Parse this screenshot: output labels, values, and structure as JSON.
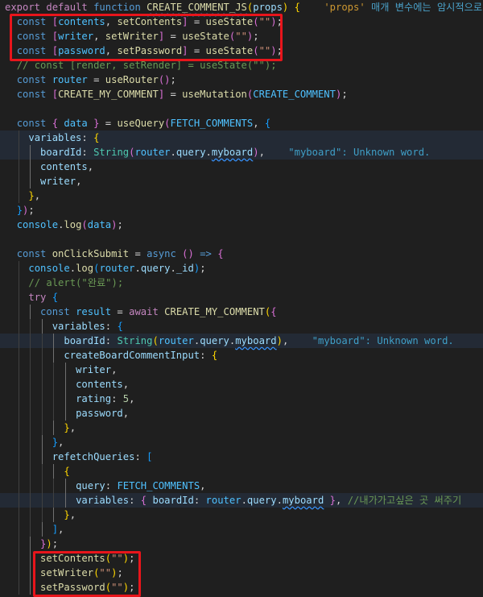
{
  "colors": {
    "editor_background": "#1f1f1f",
    "highlight_box": "#e8151b",
    "keyword": "#569cd6",
    "function": "#dcdcaa",
    "string": "#ce9178",
    "variable": "#9cdcfe",
    "comment": "#6a9955"
  },
  "lines": [
    {
      "indent": 0,
      "tokens": [
        {
          "t": "export",
          "c": "ctrl"
        },
        {
          "t": " ",
          "c": "p"
        },
        {
          "t": "default",
          "c": "ctrl"
        },
        {
          "t": " ",
          "c": "p"
        },
        {
          "t": "function",
          "c": "kw"
        },
        {
          "t": " ",
          "c": "p"
        },
        {
          "t": "CREATE_COMMENT_JS",
          "c": "fn sq"
        },
        {
          "t": "(",
          "c": "b1"
        },
        {
          "t": "props",
          "c": "var"
        },
        {
          "t": ")",
          "c": "b1"
        },
        {
          "t": " ",
          "c": "p"
        },
        {
          "t": "{",
          "c": "b1"
        },
        {
          "t": "    ",
          "c": "p"
        },
        {
          "t": "'props'",
          "c": "hintk"
        },
        {
          "t": " 매개 변수에는 암시적으로 'a",
          "c": "hint warn"
        }
      ]
    },
    {
      "indent": 1,
      "tokens": [
        {
          "t": "const",
          "c": "kw"
        },
        {
          "t": " ",
          "c": "p"
        },
        {
          "t": "[",
          "c": "b2"
        },
        {
          "t": "contents",
          "c": "cst"
        },
        {
          "t": ", ",
          "c": "p"
        },
        {
          "t": "setContents",
          "c": "fn"
        },
        {
          "t": "]",
          "c": "b2"
        },
        {
          "t": " = ",
          "c": "p"
        },
        {
          "t": "useState",
          "c": "fn"
        },
        {
          "t": "(",
          "c": "b2"
        },
        {
          "t": "\"\"",
          "c": "str"
        },
        {
          "t": ")",
          "c": "b2"
        },
        {
          "t": ";",
          "c": "p"
        }
      ]
    },
    {
      "indent": 1,
      "tokens": [
        {
          "t": "const",
          "c": "kw"
        },
        {
          "t": " ",
          "c": "p"
        },
        {
          "t": "[",
          "c": "b2"
        },
        {
          "t": "writer",
          "c": "cst"
        },
        {
          "t": ", ",
          "c": "p"
        },
        {
          "t": "setWriter",
          "c": "fn"
        },
        {
          "t": "]",
          "c": "b2"
        },
        {
          "t": " = ",
          "c": "p"
        },
        {
          "t": "useState",
          "c": "fn"
        },
        {
          "t": "(",
          "c": "b2"
        },
        {
          "t": "\"\"",
          "c": "str"
        },
        {
          "t": ")",
          "c": "b2"
        },
        {
          "t": ";",
          "c": "p"
        }
      ]
    },
    {
      "indent": 1,
      "tokens": [
        {
          "t": "const",
          "c": "kw"
        },
        {
          "t": " ",
          "c": "p"
        },
        {
          "t": "[",
          "c": "b2"
        },
        {
          "t": "password",
          "c": "cst"
        },
        {
          "t": ", ",
          "c": "p"
        },
        {
          "t": "setPassword",
          "c": "fn"
        },
        {
          "t": "]",
          "c": "b2"
        },
        {
          "t": " = ",
          "c": "p"
        },
        {
          "t": "useState",
          "c": "fn"
        },
        {
          "t": "(",
          "c": "b2"
        },
        {
          "t": "\"\"",
          "c": "str"
        },
        {
          "t": ")",
          "c": "b2"
        },
        {
          "t": ";",
          "c": "p"
        }
      ]
    },
    {
      "indent": 1,
      "tokens": [
        {
          "t": "// const [render, setRender] = useState(\"\");",
          "c": "cmt"
        }
      ]
    },
    {
      "indent": 1,
      "tokens": [
        {
          "t": "const",
          "c": "kw"
        },
        {
          "t": " ",
          "c": "p"
        },
        {
          "t": "router",
          "c": "cst"
        },
        {
          "t": " = ",
          "c": "p"
        },
        {
          "t": "useRouter",
          "c": "fn"
        },
        {
          "t": "()",
          "c": "b2"
        },
        {
          "t": ";",
          "c": "p"
        }
      ]
    },
    {
      "indent": 1,
      "tokens": [
        {
          "t": "const",
          "c": "kw"
        },
        {
          "t": " ",
          "c": "p"
        },
        {
          "t": "[",
          "c": "b2"
        },
        {
          "t": "CREATE_MY_COMMENT",
          "c": "fn"
        },
        {
          "t": "]",
          "c": "b2"
        },
        {
          "t": " = ",
          "c": "p"
        },
        {
          "t": "useMutation",
          "c": "fn"
        },
        {
          "t": "(",
          "c": "b2"
        },
        {
          "t": "CREATE_COMMENT",
          "c": "cst"
        },
        {
          "t": ")",
          "c": "b2"
        },
        {
          "t": ";",
          "c": "p"
        }
      ]
    },
    {
      "indent": 0,
      "tokens": []
    },
    {
      "indent": 1,
      "tokens": [
        {
          "t": "const",
          "c": "kw"
        },
        {
          "t": " ",
          "c": "p"
        },
        {
          "t": "{",
          "c": "b2"
        },
        {
          "t": " data ",
          "c": "cst"
        },
        {
          "t": "}",
          "c": "b2"
        },
        {
          "t": " = ",
          "c": "p"
        },
        {
          "t": "useQuery",
          "c": "fn"
        },
        {
          "t": "(",
          "c": "b2"
        },
        {
          "t": "FETCH_COMMENTS",
          "c": "cst"
        },
        {
          "t": ", ",
          "c": "p"
        },
        {
          "t": "{",
          "c": "b3"
        }
      ]
    },
    {
      "indent": 2,
      "hl": true,
      "tokens": [
        {
          "t": "variables",
          "c": "var"
        },
        {
          "t": ": ",
          "c": "p"
        },
        {
          "t": "{",
          "c": "b1"
        }
      ]
    },
    {
      "indent": 3,
      "hl": true,
      "tokens": [
        {
          "t": "boardId",
          "c": "var"
        },
        {
          "t": ": ",
          "c": "p"
        },
        {
          "t": "String",
          "c": "type"
        },
        {
          "t": "(",
          "c": "b2"
        },
        {
          "t": "router",
          "c": "cst"
        },
        {
          "t": ".",
          "c": "p"
        },
        {
          "t": "query",
          "c": "var"
        },
        {
          "t": ".",
          "c": "p"
        },
        {
          "t": "myboard",
          "c": "var sq"
        },
        {
          "t": ")",
          "c": "b2"
        },
        {
          "t": ",",
          "c": "p"
        },
        {
          "t": "    ",
          "c": "p"
        },
        {
          "t": "\"myboard\": Unknown word.",
          "c": "hint"
        }
      ]
    },
    {
      "indent": 3,
      "tokens": [
        {
          "t": "contents",
          "c": "var"
        },
        {
          "t": ",",
          "c": "p"
        }
      ]
    },
    {
      "indent": 3,
      "tokens": [
        {
          "t": "writer",
          "c": "var"
        },
        {
          "t": ",",
          "c": "p"
        }
      ]
    },
    {
      "indent": 2,
      "tokens": [
        {
          "t": "}",
          "c": "b1"
        },
        {
          "t": ",",
          "c": "p"
        }
      ]
    },
    {
      "indent": 1,
      "tokens": [
        {
          "t": "}",
          "c": "b3"
        },
        {
          "t": ")",
          "c": "b2"
        },
        {
          "t": ";",
          "c": "p"
        }
      ]
    },
    {
      "indent": 1,
      "tokens": [
        {
          "t": "console",
          "c": "cst"
        },
        {
          "t": ".",
          "c": "p"
        },
        {
          "t": "log",
          "c": "fn"
        },
        {
          "t": "(",
          "c": "b2"
        },
        {
          "t": "data",
          "c": "cst"
        },
        {
          "t": ")",
          "c": "b2"
        },
        {
          "t": ";",
          "c": "p"
        }
      ]
    },
    {
      "indent": 0,
      "tokens": []
    },
    {
      "indent": 1,
      "tokens": [
        {
          "t": "const",
          "c": "kw"
        },
        {
          "t": " ",
          "c": "p"
        },
        {
          "t": "onClickSubmit",
          "c": "fn"
        },
        {
          "t": " = ",
          "c": "p"
        },
        {
          "t": "async",
          "c": "kw"
        },
        {
          "t": " ",
          "c": "p"
        },
        {
          "t": "()",
          "c": "b2"
        },
        {
          "t": " ",
          "c": "p"
        },
        {
          "t": "=>",
          "c": "kw"
        },
        {
          "t": " ",
          "c": "p"
        },
        {
          "t": "{",
          "c": "b2"
        }
      ]
    },
    {
      "indent": 2,
      "tokens": [
        {
          "t": "console",
          "c": "cst"
        },
        {
          "t": ".",
          "c": "p"
        },
        {
          "t": "log",
          "c": "fn"
        },
        {
          "t": "(",
          "c": "b3"
        },
        {
          "t": "router",
          "c": "cst"
        },
        {
          "t": ".",
          "c": "p"
        },
        {
          "t": "query",
          "c": "var"
        },
        {
          "t": ".",
          "c": "p"
        },
        {
          "t": "_id",
          "c": "var"
        },
        {
          "t": ")",
          "c": "b3"
        },
        {
          "t": ";",
          "c": "p"
        }
      ]
    },
    {
      "indent": 2,
      "tokens": [
        {
          "t": "// alert(\"완료\");",
          "c": "cmt"
        }
      ]
    },
    {
      "indent": 2,
      "tokens": [
        {
          "t": "try",
          "c": "ctrl"
        },
        {
          "t": " ",
          "c": "p"
        },
        {
          "t": "{",
          "c": "b3"
        }
      ]
    },
    {
      "indent": 3,
      "tokens": [
        {
          "t": "const",
          "c": "kw"
        },
        {
          "t": " ",
          "c": "p"
        },
        {
          "t": "result",
          "c": "cst"
        },
        {
          "t": " = ",
          "c": "p"
        },
        {
          "t": "await",
          "c": "ctrl"
        },
        {
          "t": " ",
          "c": "p"
        },
        {
          "t": "CREATE_MY_COMMENT",
          "c": "fn"
        },
        {
          "t": "(",
          "c": "b1"
        },
        {
          "t": "{",
          "c": "b2"
        }
      ]
    },
    {
      "indent": 4,
      "tokens": [
        {
          "t": "variables",
          "c": "var"
        },
        {
          "t": ": ",
          "c": "p"
        },
        {
          "t": "{",
          "c": "b3"
        }
      ]
    },
    {
      "indent": 5,
      "hl": true,
      "tokens": [
        {
          "t": "boardId",
          "c": "var"
        },
        {
          "t": ": ",
          "c": "p"
        },
        {
          "t": "String",
          "c": "type"
        },
        {
          "t": "(",
          "c": "b1"
        },
        {
          "t": "router",
          "c": "cst"
        },
        {
          "t": ".",
          "c": "p"
        },
        {
          "t": "query",
          "c": "var"
        },
        {
          "t": ".",
          "c": "p"
        },
        {
          "t": "myboard",
          "c": "var sq"
        },
        {
          "t": ")",
          "c": "b1"
        },
        {
          "t": ",",
          "c": "p"
        },
        {
          "t": "    ",
          "c": "p"
        },
        {
          "t": "\"myboard\": Unknown word.",
          "c": "hint"
        }
      ]
    },
    {
      "indent": 5,
      "tokens": [
        {
          "t": "createBoardCommentInput",
          "c": "var"
        },
        {
          "t": ": ",
          "c": "p"
        },
        {
          "t": "{",
          "c": "b1"
        }
      ]
    },
    {
      "indent": 6,
      "tokens": [
        {
          "t": "writer",
          "c": "var"
        },
        {
          "t": ",",
          "c": "p"
        }
      ]
    },
    {
      "indent": 6,
      "tokens": [
        {
          "t": "contents",
          "c": "var"
        },
        {
          "t": ",",
          "c": "p"
        }
      ]
    },
    {
      "indent": 6,
      "tokens": [
        {
          "t": "rating",
          "c": "var"
        },
        {
          "t": ": ",
          "c": "p"
        },
        {
          "t": "5",
          "c": "num"
        },
        {
          "t": ",",
          "c": "p"
        }
      ]
    },
    {
      "indent": 6,
      "tokens": [
        {
          "t": "password",
          "c": "var"
        },
        {
          "t": ",",
          "c": "p"
        }
      ]
    },
    {
      "indent": 5,
      "tokens": [
        {
          "t": "}",
          "c": "b1"
        },
        {
          "t": ",",
          "c": "p"
        }
      ]
    },
    {
      "indent": 4,
      "tokens": [
        {
          "t": "}",
          "c": "b3"
        },
        {
          "t": ",",
          "c": "p"
        }
      ]
    },
    {
      "indent": 4,
      "tokens": [
        {
          "t": "refetchQueries",
          "c": "var"
        },
        {
          "t": ": ",
          "c": "p"
        },
        {
          "t": "[",
          "c": "b3"
        }
      ]
    },
    {
      "indent": 5,
      "tokens": [
        {
          "t": "{",
          "c": "b1"
        }
      ]
    },
    {
      "indent": 6,
      "tokens": [
        {
          "t": "query",
          "c": "var"
        },
        {
          "t": ": ",
          "c": "p"
        },
        {
          "t": "FETCH_COMMENTS",
          "c": "cst"
        },
        {
          "t": ",",
          "c": "p"
        }
      ]
    },
    {
      "indent": 6,
      "hl": true,
      "tokens": [
        {
          "t": "variables",
          "c": "var"
        },
        {
          "t": ": ",
          "c": "p"
        },
        {
          "t": "{",
          "c": "b2"
        },
        {
          "t": " ",
          "c": "p"
        },
        {
          "t": "boardId",
          "c": "var"
        },
        {
          "t": ": ",
          "c": "p"
        },
        {
          "t": "router",
          "c": "cst"
        },
        {
          "t": ".",
          "c": "p"
        },
        {
          "t": "query",
          "c": "var"
        },
        {
          "t": ".",
          "c": "p"
        },
        {
          "t": "myboard",
          "c": "var sq"
        },
        {
          "t": " ",
          "c": "p"
        },
        {
          "t": "}",
          "c": "b2"
        },
        {
          "t": ", ",
          "c": "p"
        },
        {
          "t": "//내가가고싶은 곳 써주기",
          "c": "cmt"
        },
        {
          "t": "    ",
          "c": "p"
        },
        {
          "t": "\"m",
          "c": "hint"
        }
      ]
    },
    {
      "indent": 5,
      "tokens": [
        {
          "t": "}",
          "c": "b1"
        },
        {
          "t": ",",
          "c": "p"
        }
      ]
    },
    {
      "indent": 4,
      "tokens": [
        {
          "t": "]",
          "c": "b3"
        },
        {
          "t": ",",
          "c": "p"
        }
      ]
    },
    {
      "indent": 3,
      "tokens": [
        {
          "t": "}",
          "c": "b2"
        },
        {
          "t": ")",
          "c": "b1"
        },
        {
          "t": ";",
          "c": "p"
        }
      ]
    },
    {
      "indent": 3,
      "tokens": [
        {
          "t": "setContents",
          "c": "fn"
        },
        {
          "t": "(",
          "c": "b1"
        },
        {
          "t": "\"\"",
          "c": "str"
        },
        {
          "t": ")",
          "c": "b1"
        },
        {
          "t": ";",
          "c": "p"
        }
      ]
    },
    {
      "indent": 3,
      "tokens": [
        {
          "t": "setWriter",
          "c": "fn"
        },
        {
          "t": "(",
          "c": "b1"
        },
        {
          "t": "\"\"",
          "c": "str"
        },
        {
          "t": ")",
          "c": "b1"
        },
        {
          "t": ";",
          "c": "p"
        }
      ]
    },
    {
      "indent": 3,
      "tokens": [
        {
          "t": "setPassword",
          "c": "fn"
        },
        {
          "t": "(",
          "c": "b1"
        },
        {
          "t": "\"\"",
          "c": "str"
        },
        {
          "t": ")",
          "c": "b1"
        },
        {
          "t": ";",
          "c": "p"
        }
      ]
    }
  ]
}
